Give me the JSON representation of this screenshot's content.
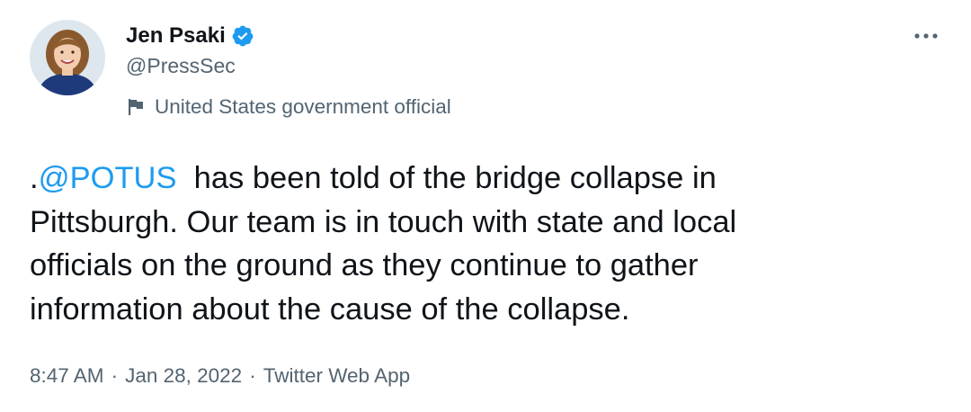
{
  "author": {
    "display_name": "Jen Psaki",
    "handle": "@PressSec",
    "label": "United States government official",
    "verified": true
  },
  "tweet": {
    "prefix": ".",
    "mention": "@POTUS",
    "text": "  has been told of the bridge collapse in\nPittsburgh. Our team is in touch with state and local\nofficials on the ground as they continue to gather\ninformation about the cause of the collapse."
  },
  "meta": {
    "time": "8:47 AM",
    "date": "Jan 28, 2022",
    "source": "Twitter Web App",
    "separator": "·"
  },
  "colors": {
    "accent": "#1d9bf0",
    "text": "#0f1419",
    "secondary": "#536471"
  },
  "icons": {
    "verified": "verified-badge-icon",
    "label": "flag-icon",
    "more": "more-horizontal-icon"
  }
}
